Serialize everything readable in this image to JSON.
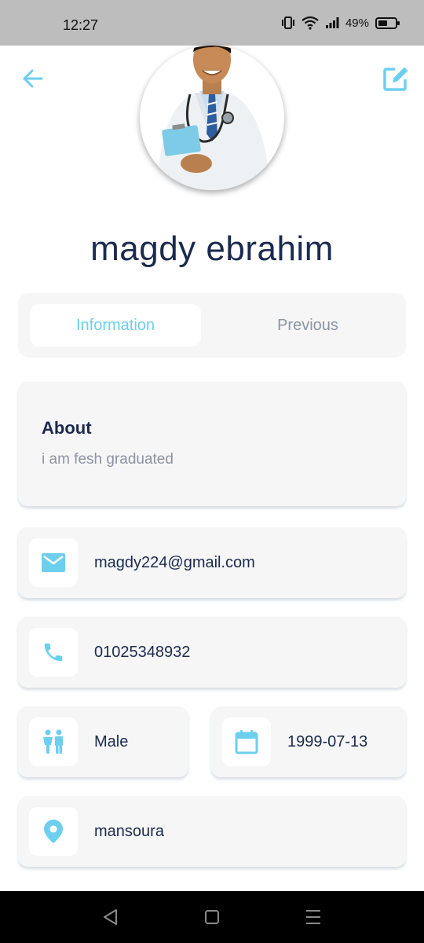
{
  "status_bar": {
    "time": "12:27",
    "battery": "49%"
  },
  "header": {
    "back_icon": "arrow-left-icon",
    "edit_icon": "edit-square-icon",
    "accent_color": "#6dcfee"
  },
  "profile": {
    "name": "magdy ebrahim",
    "avatar": "doctor-photo"
  },
  "tabs": [
    {
      "label": "Information",
      "active": true
    },
    {
      "label": "Previous",
      "active": false
    }
  ],
  "about": {
    "title": "About",
    "text": "i am fesh graduated"
  },
  "details": {
    "email": "magdy224@gmail.com",
    "phone": "01025348932",
    "gender": "Male",
    "birth_date": "1999-07-13",
    "location": "mansoura"
  },
  "nav": {
    "back_icon": "triangle-back-icon",
    "home_icon": "square-home-icon",
    "menu_icon": "three-lines-menu-icon"
  }
}
